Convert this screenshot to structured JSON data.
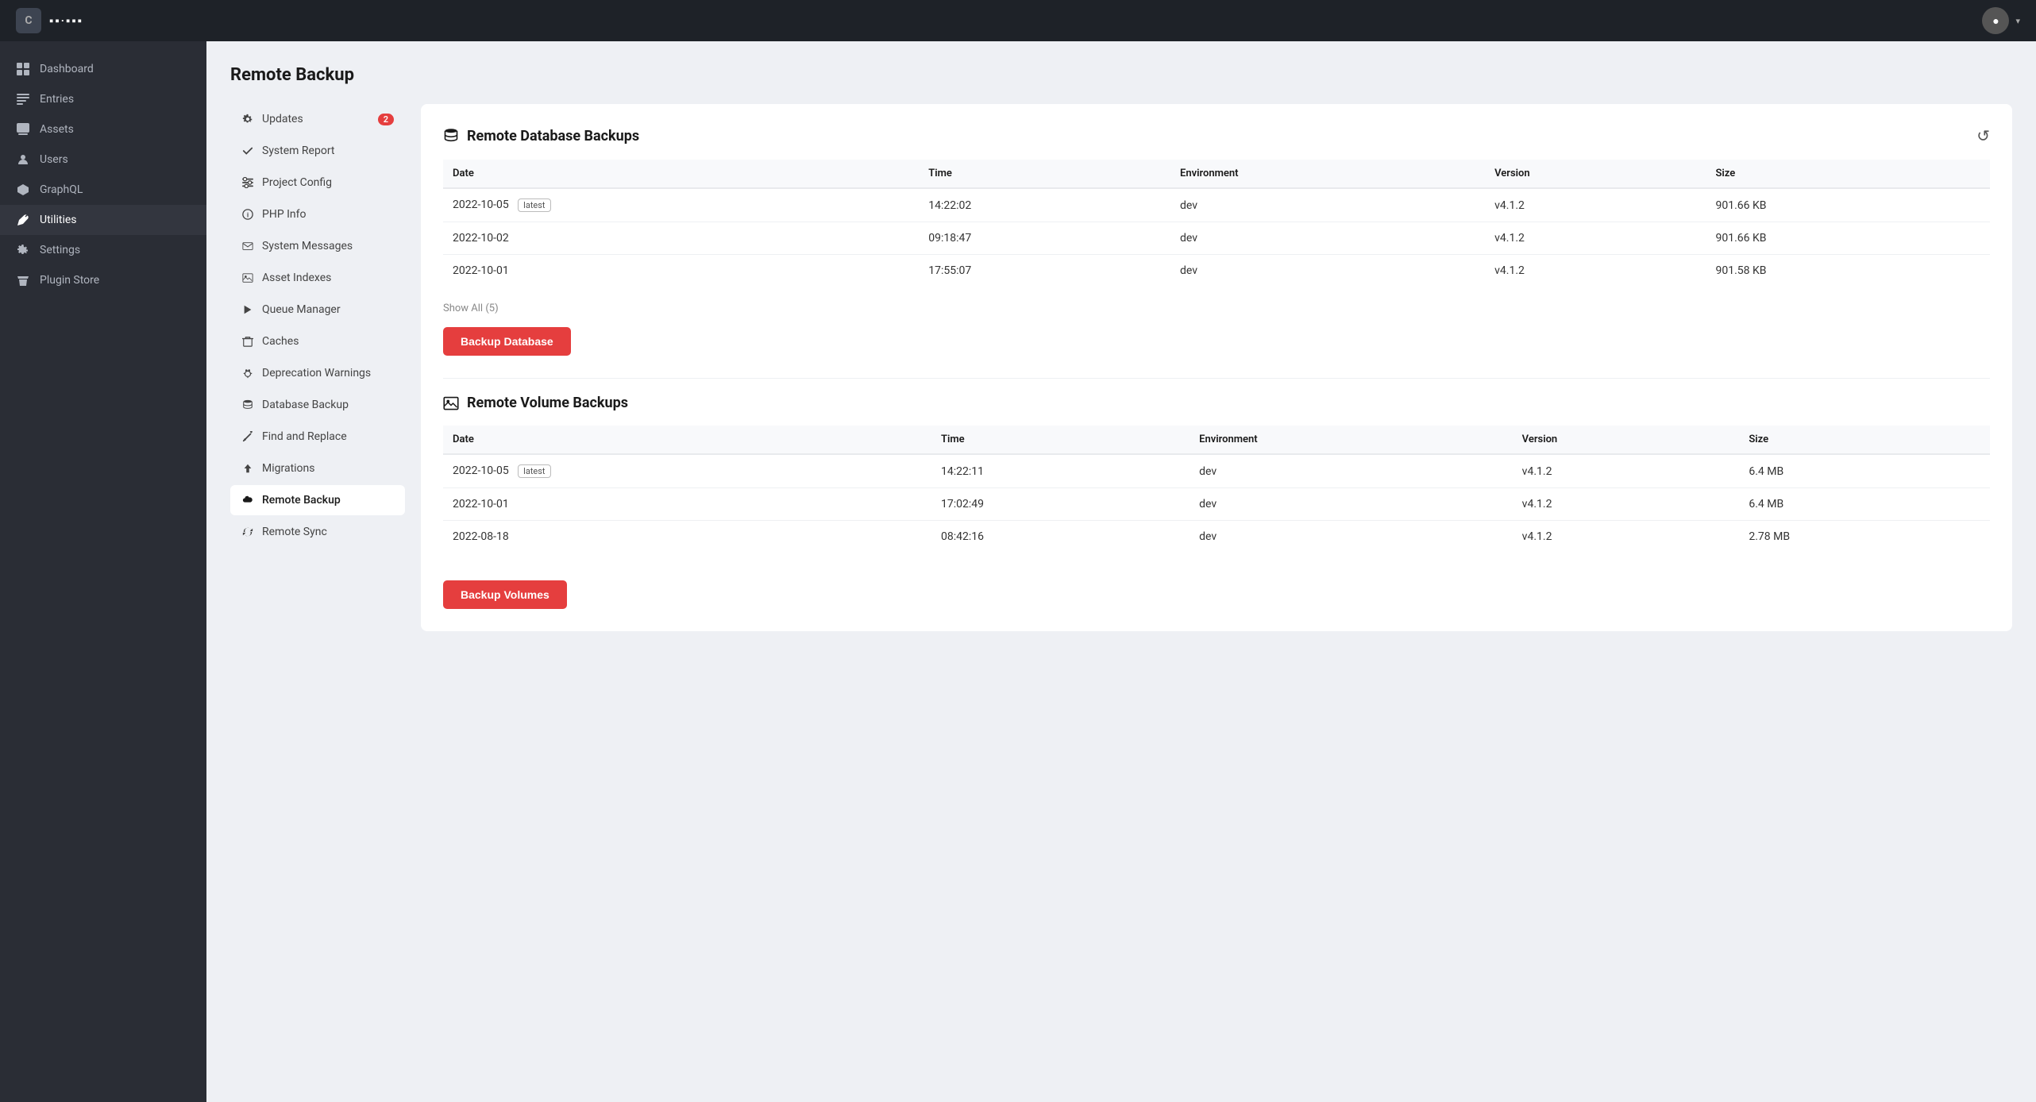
{
  "topbar": {
    "logo": "C",
    "brand": "▪▪·▪▪▪"
  },
  "sidebar": {
    "items": [
      {
        "id": "dashboard",
        "label": "Dashboard",
        "icon": "dashboard"
      },
      {
        "id": "entries",
        "label": "Entries",
        "icon": "entries"
      },
      {
        "id": "assets",
        "label": "Assets",
        "icon": "assets"
      },
      {
        "id": "users",
        "label": "Users",
        "icon": "users"
      },
      {
        "id": "graphql",
        "label": "GraphQL",
        "icon": "graphql"
      },
      {
        "id": "utilities",
        "label": "Utilities",
        "icon": "utilities",
        "active": true
      },
      {
        "id": "settings",
        "label": "Settings",
        "icon": "settings"
      },
      {
        "id": "plugin-store",
        "label": "Plugin Store",
        "icon": "plugin-store"
      }
    ]
  },
  "subnav": {
    "items": [
      {
        "id": "updates",
        "label": "Updates",
        "icon": "gear",
        "badge": 2
      },
      {
        "id": "system-report",
        "label": "System Report",
        "icon": "check"
      },
      {
        "id": "project-config",
        "label": "Project Config",
        "icon": "sliders"
      },
      {
        "id": "php-info",
        "label": "PHP Info",
        "icon": "info"
      },
      {
        "id": "system-messages",
        "label": "System Messages",
        "icon": "envelope"
      },
      {
        "id": "asset-indexes",
        "label": "Asset Indexes",
        "icon": "image"
      },
      {
        "id": "queue-manager",
        "label": "Queue Manager",
        "icon": "play"
      },
      {
        "id": "caches",
        "label": "Caches",
        "icon": "trash"
      },
      {
        "id": "deprecation-warnings",
        "label": "Deprecation Warnings",
        "icon": "bug"
      },
      {
        "id": "database-backup",
        "label": "Database Backup",
        "icon": "database"
      },
      {
        "id": "find-replace",
        "label": "Find and Replace",
        "icon": "wand"
      },
      {
        "id": "migrations",
        "label": "Migrations",
        "icon": "upload"
      },
      {
        "id": "remote-backup",
        "label": "Remote Backup",
        "icon": "cloud",
        "active": true
      },
      {
        "id": "remote-sync",
        "label": "Remote Sync",
        "icon": "sync"
      }
    ]
  },
  "page": {
    "title": "Remote Backup",
    "db_section_title": "Remote Database Backups",
    "vol_section_title": "Remote Volume Backups",
    "db_columns": [
      "Date",
      "Time",
      "Environment",
      "Version",
      "Size"
    ],
    "db_rows": [
      {
        "date": "2022-10-05",
        "latest": true,
        "time": "14:22:02",
        "env": "dev",
        "version": "v4.1.2",
        "size": "901.66 KB"
      },
      {
        "date": "2022-10-02",
        "latest": false,
        "time": "09:18:47",
        "env": "dev",
        "version": "v4.1.2",
        "size": "901.66 KB"
      },
      {
        "date": "2022-10-01",
        "latest": false,
        "time": "17:55:07",
        "env": "dev",
        "version": "v4.1.2",
        "size": "901.58 KB"
      }
    ],
    "db_show_all": "Show All (5)",
    "btn_backup_db": "Backup Database",
    "vol_columns": [
      "Date",
      "Time",
      "Environment",
      "Version",
      "Size"
    ],
    "vol_rows": [
      {
        "date": "2022-10-05",
        "latest": true,
        "time": "14:22:11",
        "env": "dev",
        "version": "v4.1.2",
        "size": "6.4 MB"
      },
      {
        "date": "2022-10-01",
        "latest": false,
        "time": "17:02:49",
        "env": "dev",
        "version": "v4.1.2",
        "size": "6.4 MB"
      },
      {
        "date": "2022-08-18",
        "latest": false,
        "time": "08:42:16",
        "env": "dev",
        "version": "v4.1.2",
        "size": "2.78 MB"
      }
    ],
    "btn_backup_vol": "Backup Volumes"
  }
}
